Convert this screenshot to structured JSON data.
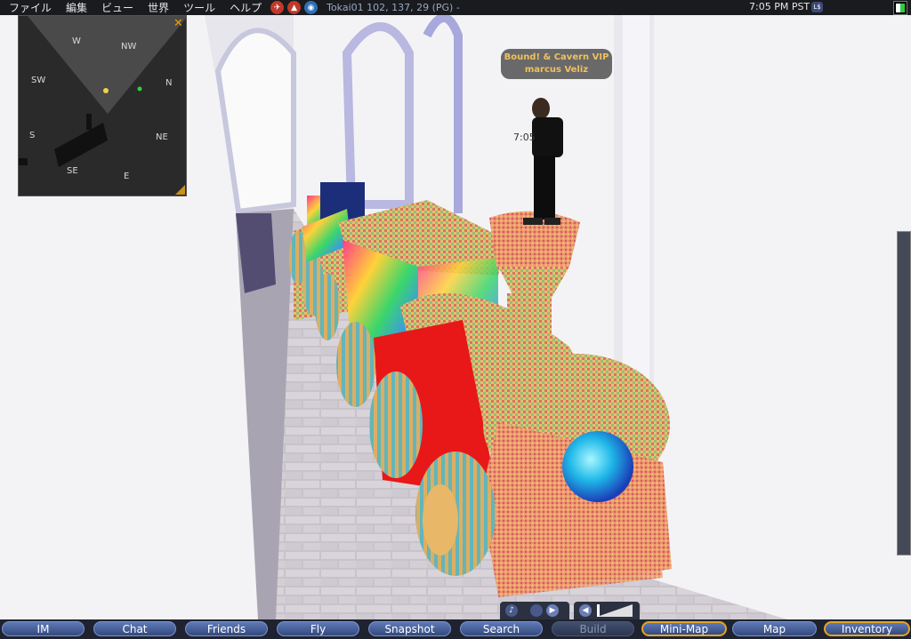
{
  "menu": {
    "items": [
      "ファイル",
      "編集",
      "ビュー",
      "世界",
      "ツール",
      "ヘルプ"
    ]
  },
  "status": {
    "icons": [
      "no-fly-icon",
      "no-build-icon",
      "voice-icon"
    ],
    "location": "Tokai01 102, 137, 29 (PG) -",
    "time": "7:05 PM PST",
    "currency_icon": "L$"
  },
  "minimap": {
    "labels": [
      "W",
      "NW",
      "SW",
      "N",
      "S",
      "NE",
      "SE",
      "E"
    ],
    "close_glyph": "✕"
  },
  "scene": {
    "name_tag": {
      "line1": "Bound! & Cavern VIP",
      "line2": "marcus Veliz"
    },
    "hover_time": "7:05"
  },
  "media": {
    "music_glyph": "♪",
    "play_glyph": "▶",
    "volume_glyph": "◀"
  },
  "toolbar": {
    "buttons": [
      "IM",
      "Chat",
      "Friends",
      "Fly",
      "Snapshot",
      "Search",
      "Build",
      "Mini-Map",
      "Map",
      "Inventory"
    ],
    "active": [
      "Mini-Map",
      "Inventory"
    ],
    "disabled": [
      "Build"
    ]
  },
  "colors": {
    "toolbar_bg": "#1f2330",
    "button_blue": "#4a64a0",
    "active_border": "#e4a420",
    "name_tag_text": "#f0c060"
  }
}
